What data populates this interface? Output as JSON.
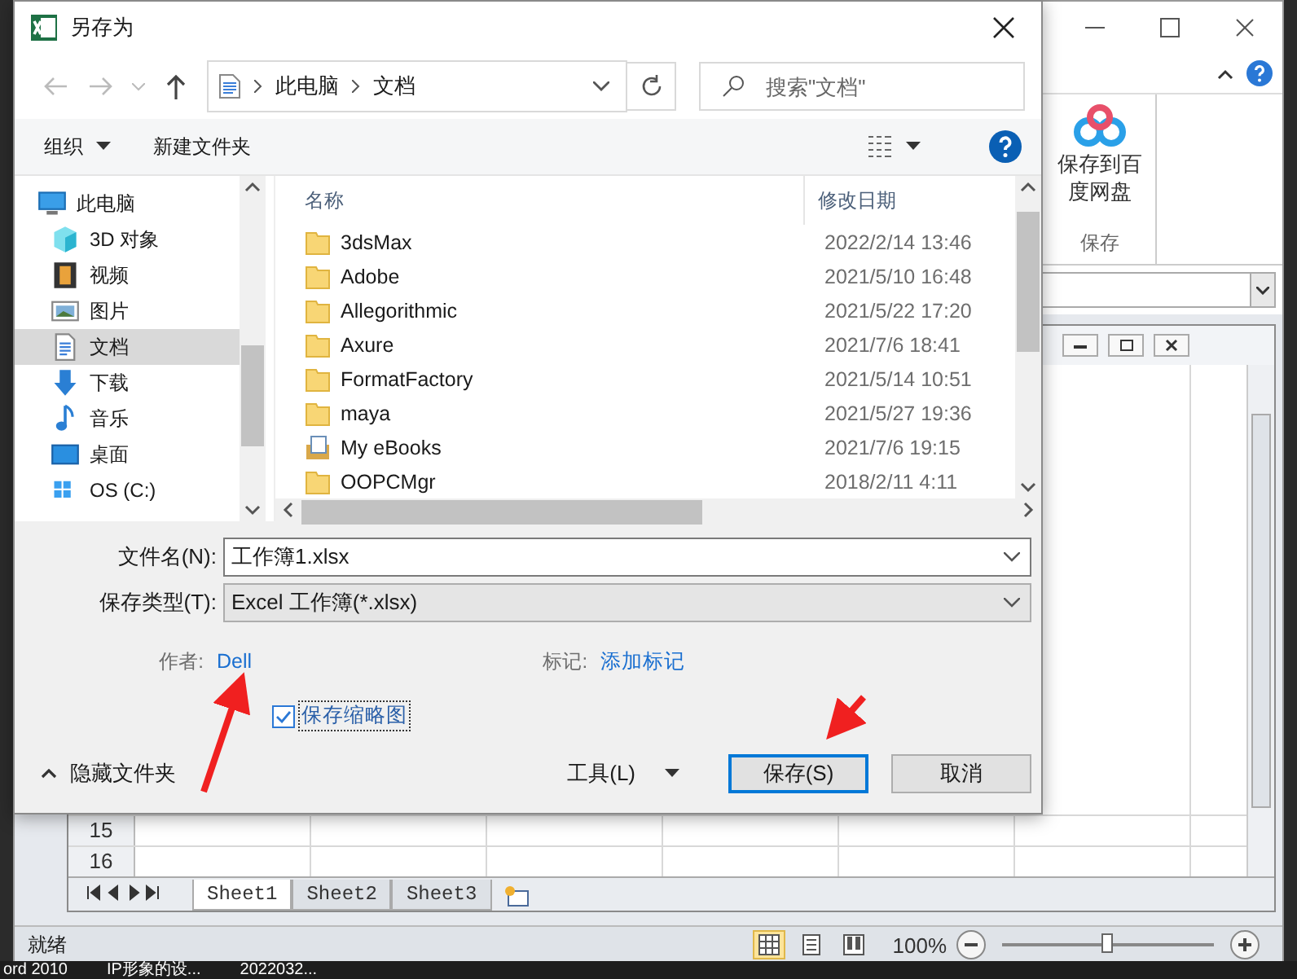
{
  "excel": {
    "ribbon_group": {
      "button": "保存到百度网盘",
      "label": "保存"
    },
    "rows": [
      "15",
      "16"
    ],
    "sheets": [
      {
        "label": "Sheet1",
        "selected": true
      },
      {
        "label": "Sheet2",
        "selected": false
      },
      {
        "label": "Sheet3",
        "selected": false
      }
    ],
    "status": "就绪",
    "view_modes": [
      {
        "kind": "normal",
        "selected": true
      },
      {
        "kind": "layout",
        "selected": false
      },
      {
        "kind": "pagebreak",
        "selected": false
      }
    ],
    "zoom": "100%",
    "zoom_slider": {
      "level": 0.5
    }
  },
  "taskbar": [
    "ord 2010",
    "IP形象的设...",
    "2022032..."
  ],
  "dialog": {
    "title": "另存为",
    "breadcrumb": [
      "此电脑",
      "文档"
    ],
    "search": {
      "placeholder": "搜索\"文档\""
    },
    "toolbar": {
      "organize": "组织",
      "new_folder": "新建文件夹"
    },
    "nav_items": [
      {
        "label": "此电脑",
        "kind": "computer",
        "selected": false
      },
      {
        "label": "3D 对象",
        "kind": "cube",
        "selected": false
      },
      {
        "label": "视频",
        "kind": "video",
        "selected": false
      },
      {
        "label": "图片",
        "kind": "picture",
        "selected": false
      },
      {
        "label": "文档",
        "kind": "document",
        "selected": true
      },
      {
        "label": "下载",
        "kind": "download",
        "selected": false
      },
      {
        "label": "音乐",
        "kind": "music",
        "selected": false
      },
      {
        "label": "桌面",
        "kind": "desktop",
        "selected": false
      },
      {
        "label": "OS (C:)",
        "kind": "drive",
        "selected": false
      }
    ],
    "columns": [
      "名称",
      "修改日期"
    ],
    "files": [
      {
        "name": "3dsMax",
        "date": "2022/2/14 13:46",
        "kind": "folder",
        "selected": false
      },
      {
        "name": "Adobe",
        "date": "2021/5/10 16:48",
        "kind": "folder",
        "selected": false
      },
      {
        "name": "Allegorithmic",
        "date": "2021/5/22 17:20",
        "kind": "folder",
        "selected": false
      },
      {
        "name": "Axure",
        "date": "2021/7/6 18:41",
        "kind": "folder",
        "selected": false
      },
      {
        "name": "FormatFactory",
        "date": "2021/5/14 10:51",
        "kind": "folder",
        "selected": false
      },
      {
        "name": "maya",
        "date": "2021/5/27 19:36",
        "kind": "folder",
        "selected": false
      },
      {
        "name": "My eBooks",
        "date": "2021/7/6 19:15",
        "kind": "library",
        "selected": false
      },
      {
        "name": "OOPCMgr",
        "date": "2018/2/11 4:11",
        "kind": "folder",
        "selected": false
      }
    ],
    "file_name": {
      "label": "文件名(N):",
      "value": "工作簿1.xlsx"
    },
    "save_type": {
      "label": "保存类型(T):",
      "value": "Excel 工作簿(*.xlsx)"
    },
    "author": {
      "label": "作者:",
      "value": "Dell"
    },
    "tags": {
      "label": "标记:",
      "value": "添加标记"
    },
    "thumbnail": {
      "label": "保存缩略图",
      "checked": true
    },
    "hide_folders": "隐藏文件夹",
    "tools": "工具(L)",
    "save": "保存(S)",
    "cancel": "取消"
  }
}
